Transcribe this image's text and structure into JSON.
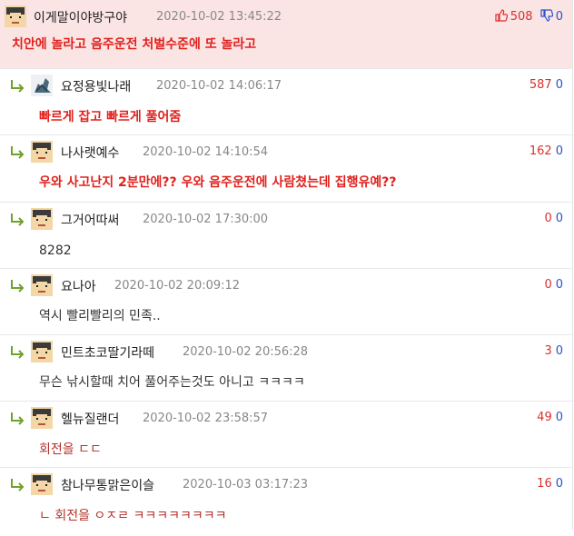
{
  "post": {
    "nick": "이게말이야방구야",
    "date": "2020-10-02 13:45:22",
    "up": "508",
    "down": "0",
    "text": "치안에 놀라고 음주운전 처벌수준에 또 놀라고"
  },
  "replies": [
    {
      "nick": "요정용빛나래",
      "date": "2020-10-02 14:06:17",
      "up": "587",
      "down": "0",
      "text": "빠르게 잡고 빠르게 풀어줌"
    },
    {
      "nick": "나사랫예수",
      "date": "2020-10-02 14:10:54",
      "up": "162",
      "down": "0",
      "text": "우와 사고난지 2분만에?? 우와 음주운전에 사람쳤는데 집행유예??"
    },
    {
      "nick": "그거어따써",
      "date": "2020-10-02 17:30:00",
      "up": "0",
      "down": "0",
      "text": "8282"
    },
    {
      "nick": "요나아",
      "date": "2020-10-02 20:09:12",
      "up": "0",
      "down": "0",
      "text": "역시 빨리빨리의 민족.."
    },
    {
      "nick": "민트초코딸기라떼",
      "date": "2020-10-02 20:56:28",
      "up": "3",
      "down": "0",
      "text": "무슨 낚시할때 치어 풀어주는것도 아니고 ㅋㅋㅋㅋ"
    },
    {
      "nick": "헬뉴질랜더",
      "date": "2020-10-02 23:58:57",
      "up": "49",
      "down": "0",
      "text": "회전을 ㄷㄷ"
    },
    {
      "nick": "참나무통맑은이슬",
      "date": "2020-10-03 03:17:23",
      "up": "16",
      "down": "0",
      "text": "ㄴ 회전을 ㅇㅈㄹ ㅋㅋㅋㅋㅋㅋㅋㅋ"
    }
  ],
  "colors": {
    "accent_red": "#e0211d",
    "op_bg": "#fbe4e4",
    "reply_icon": "#6fa22b",
    "downvote": "#2d52c7"
  }
}
